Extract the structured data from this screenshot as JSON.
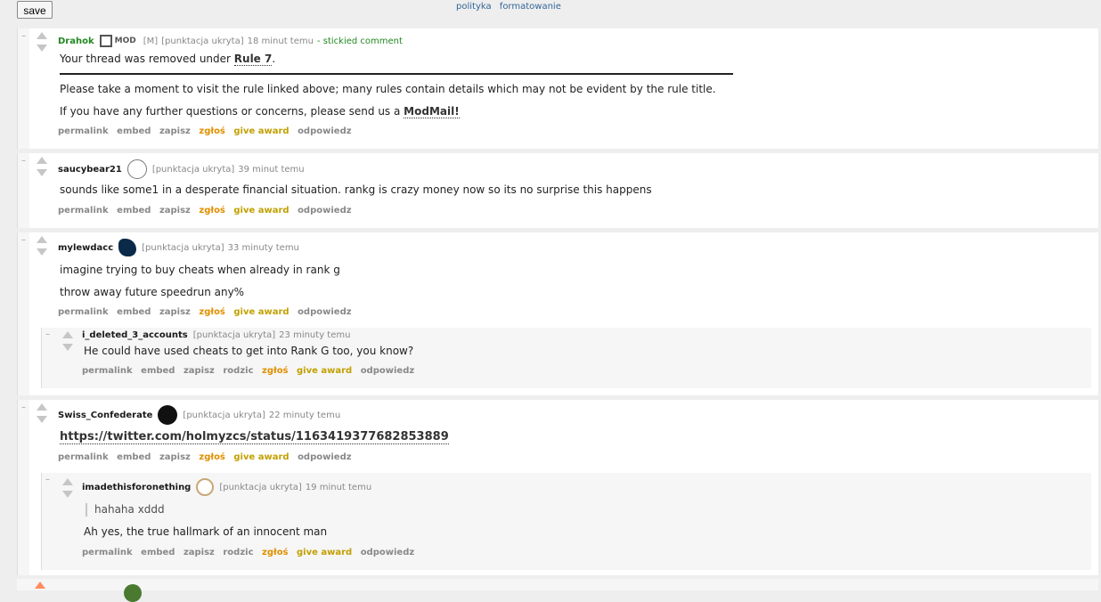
{
  "top": {
    "save_label": "save",
    "links": [
      "polityka",
      "formatowanie"
    ]
  },
  "comments": [
    {
      "author": "Drahok",
      "mod_badge": "MOD",
      "flag": "[M]",
      "score": "[punktacja ukryta]",
      "time": "18 minut temu",
      "sticky": "- stickied comment",
      "body": [
        {
          "pre": "Your thread was removed under ",
          "link": "Rule 7",
          "post": "."
        },
        {
          "pre": "Please take a moment to visit the rule linked above; many rules contain details which may not be evident by the rule title."
        },
        {
          "pre": "If you have any further questions or concerns, please send us a ",
          "link": "ModMail!"
        }
      ],
      "buttons": [
        "permalink",
        "embed",
        "zapisz",
        "zgłoś",
        "give award",
        "odpowiedz"
      ]
    },
    {
      "author": "saucybear21",
      "score": "[punktacja ukryta]",
      "time": "39 minut temu",
      "body": [
        "sounds like some1 in a desperate financial situation. rankg is crazy money now so its no surprise this happens"
      ],
      "buttons": [
        "permalink",
        "embed",
        "zapisz",
        "zgłoś",
        "give award",
        "odpowiedz"
      ]
    },
    {
      "author": "mylewdacc",
      "score": "[punktacja ukryta]",
      "time": "33 minuty temu",
      "body": [
        "imagine trying to buy cheats when already in rank g",
        "throw away future speedrun any%"
      ],
      "buttons": [
        "permalink",
        "embed",
        "zapisz",
        "zgłoś",
        "give award",
        "odpowiedz"
      ],
      "child": {
        "author": "i_deleted_3_accounts",
        "score": "[punktacja ukryta]",
        "time": "23 minuty temu",
        "body": [
          "He could have used cheats to get into Rank G too, you know?"
        ],
        "buttons": [
          "permalink",
          "embed",
          "zapisz",
          "rodzic",
          "zgłoś",
          "give award",
          "odpowiedz"
        ]
      }
    },
    {
      "author": "Swiss_Confederate",
      "score": "[punktacja ukryta]",
      "time": "22 minuty temu",
      "body_link": "https://twitter.com/holmyzcs/status/1163419377682853889",
      "buttons": [
        "permalink",
        "embed",
        "zapisz",
        "zgłoś",
        "give award",
        "odpowiedz"
      ],
      "child": {
        "author": "imadethisforonething",
        "score": "[punktacja ukryta]",
        "time": "19 minut temu",
        "quote": "hahaha xddd",
        "body": [
          "Ah yes, the true hallmark of an innocent man"
        ],
        "buttons": [
          "permalink",
          "embed",
          "zapisz",
          "rodzic",
          "zgłoś",
          "give award",
          "odpowiedz"
        ]
      }
    }
  ],
  "colors": {
    "mod_green": "#228822",
    "report_orange": "#e09000",
    "award_gold": "#c2a000"
  }
}
